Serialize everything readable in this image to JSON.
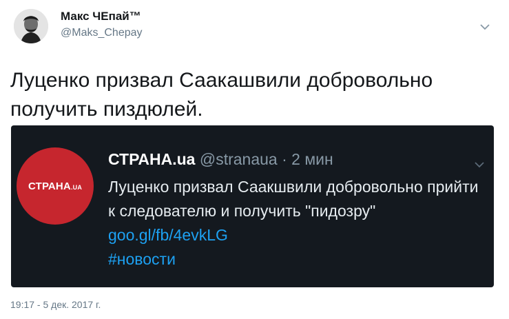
{
  "user": {
    "display_name": "Макс ЧЕпай™",
    "handle": "@Maks_Chepay"
  },
  "tweet": {
    "text": "Луценко призвал Саакашвили добровольно получить пиздюлей.",
    "timestamp": "19:17 - 5 дек. 2017 г."
  },
  "embedded": {
    "logo_text": "СТРАНА",
    "logo_suffix": ".UA",
    "author_name": "СТРАНА.ua",
    "author_handle": "@stranaua",
    "separator": " · ",
    "time": "2 мин",
    "text": "Луценко призвал Саакшвили добровольно прийти к следователю и получить \"пидозру\" ",
    "link": "goo.gl/fb/4evkLG",
    "hashtag": "#новости"
  },
  "colors": {
    "embed_bg": "#14191f",
    "logo_red": "#c6262e",
    "link_blue": "#1da1f2"
  },
  "icons": [
    "avatar-portrait",
    "chevron-down-icon"
  ]
}
